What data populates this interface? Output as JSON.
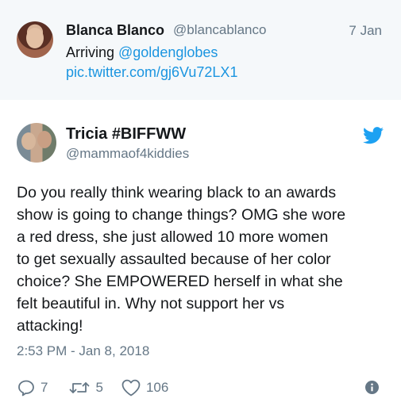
{
  "quoted_tweet": {
    "name": "Blanca Blanco",
    "handle": "@blancablanco",
    "date": "7 Jan",
    "text_prefix": "Arriving ",
    "mention": "@goldenglobes",
    "link": "pic.twitter.com/gj6Vu72LX1"
  },
  "tweet": {
    "name": "Tricia #BIFFWW",
    "handle": "@mammaof4kiddies",
    "text": "Do you really think wearing black to an awards\nshow is going to change things? OMG she wore\na red dress,  she just allowed 10 more women\nto get sexually assaulted because of her color\nchoice? She EMPOWERED herself in what she\nfelt beautiful in.  Why not support her vs\nattacking!",
    "timestamp": "2:53 PM - Jan 8, 2018"
  },
  "actions": {
    "replies": "7",
    "retweets": "5",
    "likes": "106"
  },
  "icons": {
    "brand": "twitter-bird-icon",
    "reply": "reply-icon",
    "retweet": "retweet-icon",
    "like": "heart-icon",
    "info": "info-icon"
  },
  "colors": {
    "brand": "#1da1f2",
    "link": "#1b95e0",
    "muted": "#657786",
    "quoted_background": "#f5f8fa"
  }
}
